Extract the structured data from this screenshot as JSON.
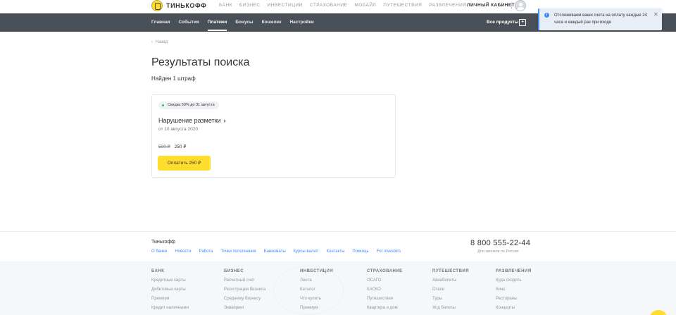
{
  "header": {
    "brand": "ТИНЬКОФФ",
    "nav": [
      "БАНК",
      "БИЗНЕС",
      "ИНВЕСТИЦИИ",
      "СТРАХОВАНИЕ",
      "МОБАЙЛ",
      "ПУТЕШЕСТВИЯ",
      "РАЗВЛЕЧЕНИЯ"
    ],
    "cabinet": "ЛИЧНЫЙ КАБИНЕТ"
  },
  "subnav": {
    "items": [
      "Главная",
      "События",
      "Платежи",
      "Бонусы",
      "Кошелек",
      "Настройки"
    ],
    "active": "Платежи",
    "all_products": "Все продукты"
  },
  "toast": {
    "text": "Отслеживаем ваши счета на оплату каждые 24 часа и каждый раз при входе",
    "close": "✕"
  },
  "main": {
    "back": "Назад",
    "title": "Результаты поиска",
    "found": "Найден 1 штраф"
  },
  "fine": {
    "badge": "Скидка 50% до 31 августа",
    "name": "Нарушение разметки",
    "date": "от 10 августа 2020",
    "old_price": "500 ₽",
    "new_price": "250 ₽",
    "pay_button": "Оплатить 250 ₽"
  },
  "footer": {
    "brand": "Тинькофф",
    "links": [
      "О банке",
      "Новости",
      "Работа",
      "Точки пополнения",
      "Банкоматы",
      "Курсы валют",
      "Контакты",
      "Помощь",
      "For investors"
    ],
    "phone": "8 800 555-22-44",
    "phone_note": "Для звонков по России",
    "columns": [
      {
        "head": "БАНК",
        "links": [
          "Кредитные карты",
          "Дебетовые карты",
          "Премиум",
          "Кредит наличными"
        ]
      },
      {
        "head": "БИЗНЕС",
        "links": [
          "Расчетный счет",
          "Регистрация бизнеса",
          "Среднему бизнесу",
          "Эквайринг"
        ]
      },
      {
        "head": "ИНВЕСТИЦИИ",
        "links": [
          "Лента",
          "Каталог",
          "Что купить",
          "Премиум"
        ]
      },
      {
        "head": "СТРАХОВАНИЕ",
        "links": [
          "ОСАГО",
          "КАСКО",
          "Путешествия",
          "Квартира и дом"
        ]
      },
      {
        "head": "ПУТЕШЕСТВИЯ",
        "links": [
          "Авиабилеты",
          "Отели",
          "Туры",
          "Ж/д билеты"
        ]
      },
      {
        "head": "РАЗВЛЕЧЕНИЯ",
        "links": [
          "Куда сходить",
          "Кино",
          "Рестораны",
          "Концерты"
        ]
      }
    ]
  },
  "colors": {
    "accent_yellow": "#ffdd2d",
    "nav_dark": "#495058",
    "link_blue": "#428bf9",
    "badge_green": "#2ec068"
  }
}
